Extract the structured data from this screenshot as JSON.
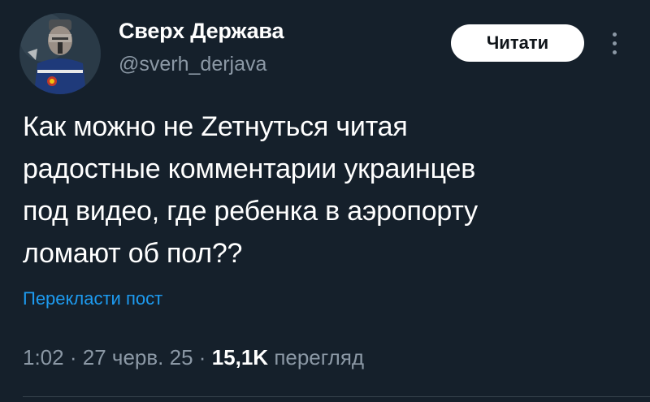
{
  "tweet": {
    "author": {
      "display_name": "Сверх Держава",
      "handle": "@sverh_derjava"
    },
    "follow_label": "Читати",
    "text_lines": [
      "Как можно не Zетнуться читая",
      "радостные комментарии украинцев",
      "под видео, где ребенка в аэропорту",
      "ломают об пол??"
    ],
    "translate_label": "Перекласти пост",
    "time": "1:02",
    "date": "27 черв. 25",
    "separator": "·",
    "views_count": "15,1K",
    "views_label": "перегляд"
  },
  "colors": {
    "background": "#15202b",
    "text_primary": "#ffffff",
    "text_secondary": "#8b98a5",
    "link": "#1d9bf0",
    "follow_button_bg": "#ffffff"
  },
  "icons": {
    "more": "more-vertical-icon"
  }
}
